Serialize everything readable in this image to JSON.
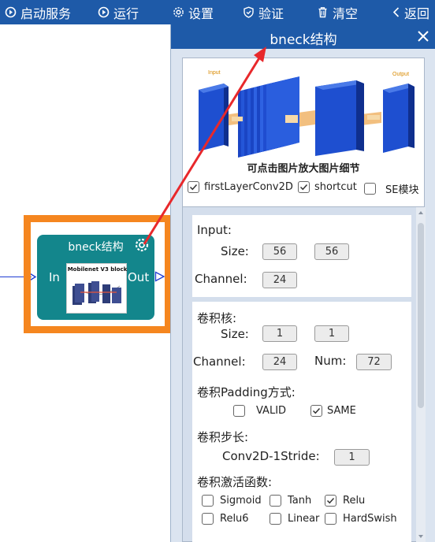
{
  "toolbar": {
    "start_service": "启动服务",
    "run": "运行",
    "settings": "设置",
    "verify": "验证",
    "clear": "清空",
    "back": "返回"
  },
  "node": {
    "title": "bneck结构",
    "in_label": "In",
    "out_label": "Out",
    "thumb_title": "Mobilenet V3 block"
  },
  "panel": {
    "title": "bneck结构",
    "image": {
      "input_label": "Input",
      "output_label": "Output",
      "caption": "可点击图片放大图片细节"
    },
    "options": [
      {
        "label": "firstLayerConv2D",
        "checked": true
      },
      {
        "label": "shortcut",
        "checked": true
      },
      {
        "label": "SE模块",
        "checked": false
      }
    ],
    "input_section": {
      "heading": "Input:",
      "size_label": "Size:",
      "size_w": "56",
      "size_h": "56",
      "channel_label": "Channel:",
      "channel": "24"
    },
    "kernel_section": {
      "heading": "卷积核:",
      "size_label": "Size:",
      "size_w": "1",
      "size_h": "1",
      "channel_label": "Channel:",
      "channel": "24",
      "num_label": "Num:",
      "num": "72",
      "padding_label": "卷积Padding方式:",
      "padding_options": [
        {
          "label": "VALID",
          "checked": false
        },
        {
          "label": "SAME",
          "checked": true
        }
      ],
      "stride_label": "卷积步长:",
      "stride_field_label": "Conv2D-1Stride:",
      "stride": "1",
      "activation_label": "卷积激活函数:",
      "activations": [
        {
          "label": "Sigmoid",
          "checked": false
        },
        {
          "label": "Tanh",
          "checked": false
        },
        {
          "label": "Relu",
          "checked": true
        },
        {
          "label": "Relu6",
          "checked": false
        },
        {
          "label": "Linear",
          "checked": false
        },
        {
          "label": "HardSwish",
          "checked": false
        }
      ]
    }
  },
  "colors": {
    "toolbar_bg": "#1e5aa8",
    "node_bg": "#13868c",
    "highlight": "#f5861f",
    "arrow": "#e8282b"
  }
}
